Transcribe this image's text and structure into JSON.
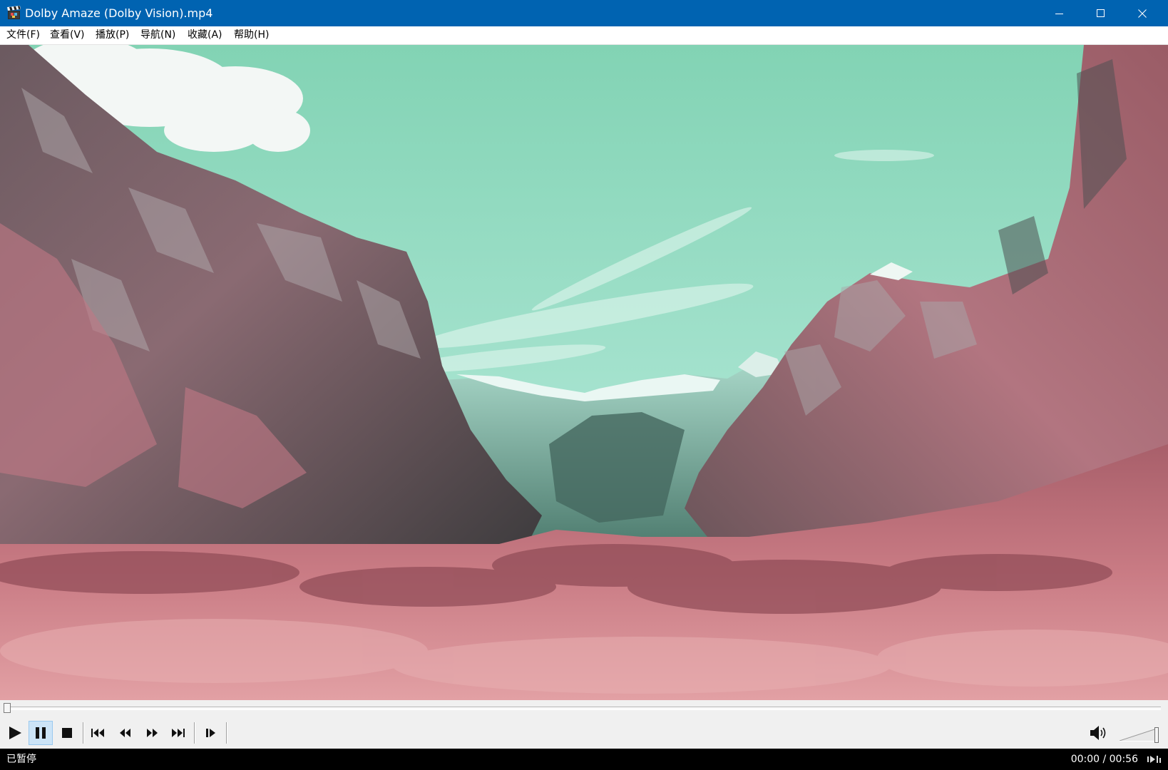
{
  "window": {
    "title": "Dolby Amaze (Dolby Vision).mp4",
    "app_icon": "clapperboard-icon",
    "controls": [
      "minimize-icon",
      "maximize-icon",
      "close-icon"
    ],
    "titlebar_color": "#0063b1"
  },
  "menu": {
    "items": [
      "文件(F)",
      "查看(V)",
      "播放(P)",
      "导航(N)",
      "收藏(A)",
      "帮助(H)"
    ]
  },
  "video": {
    "frame": "scenic mountain valley under a mint-green sky, pink-tinted slopes"
  },
  "seek": {
    "position_fraction": 0.0
  },
  "toolbar": {
    "buttons": [
      {
        "name": "play-button",
        "icon": "play-icon",
        "active": false
      },
      {
        "name": "pause-button",
        "icon": "pause-icon",
        "active": true
      },
      {
        "name": "stop-button",
        "icon": "stop-icon",
        "active": false
      },
      {
        "name": "previous-button",
        "icon": "skip-back-icon",
        "active": false
      },
      {
        "name": "rewind-button",
        "icon": "rewind-icon",
        "active": false
      },
      {
        "name": "fast-forward-button",
        "icon": "fast-forward-icon",
        "active": false
      },
      {
        "name": "next-button",
        "icon": "skip-forward-icon",
        "active": false
      },
      {
        "name": "frame-step-button",
        "icon": "frame-step-icon",
        "active": false
      }
    ],
    "volume_fraction": 1.0,
    "volume_icon": "speaker-icon"
  },
  "status": {
    "state": "已暂停",
    "time": "00:00 / 00:56",
    "icon": "stats-icon"
  }
}
